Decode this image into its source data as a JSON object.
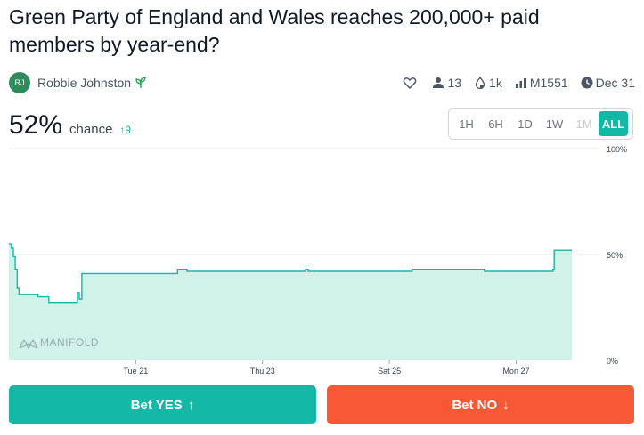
{
  "market": {
    "title": "Green Party of England and Wales reaches 200,000+ paid members by year-end?"
  },
  "author": {
    "initials": "RJ",
    "name": "Robbie Johnston",
    "avatar_color": "#2f8a5c",
    "badge_icon": "sprout-icon"
  },
  "stats": {
    "traders": "13",
    "liquidity": "1k",
    "volume": "Ṁ1551",
    "close_date": "Dec 31"
  },
  "probability": {
    "value": "52%",
    "label": "chance",
    "change": "9"
  },
  "time_ranges": [
    {
      "label": "1H",
      "state": "normal"
    },
    {
      "label": "6H",
      "state": "normal"
    },
    {
      "label": "1D",
      "state": "normal"
    },
    {
      "label": "1W",
      "state": "normal"
    },
    {
      "label": "1M",
      "state": "disabled"
    },
    {
      "label": "ALL",
      "state": "active"
    }
  ],
  "colors": {
    "accent": "#11b8a5",
    "yes": "#14b8a6",
    "no": "#f75836",
    "chart_line": "#14b8a6",
    "chart_fill": "#d1f2e8"
  },
  "chart_data": {
    "type": "area",
    "watermark": "MANIFOLD",
    "y_tick_labels": [
      "100%",
      "50%",
      "0%"
    ],
    "x_tick_labels": [
      "Tue 21",
      "Thu 23",
      "Sat 25",
      "Mon 27"
    ],
    "ylim": [
      0,
      100
    ],
    "xlim": [
      19.0,
      28.3
    ],
    "x_tick_values": [
      21,
      23,
      25,
      27
    ],
    "y_tick_values": [
      100,
      50,
      0
    ],
    "grid": true,
    "series": [
      {
        "points": [
          [
            19.0,
            55
          ],
          [
            19.04,
            55
          ],
          [
            19.04,
            53
          ],
          [
            19.07,
            53
          ],
          [
            19.07,
            49
          ],
          [
            19.1,
            49
          ],
          [
            19.1,
            43
          ],
          [
            19.13,
            43
          ],
          [
            19.13,
            34
          ],
          [
            19.16,
            34
          ],
          [
            19.16,
            31
          ],
          [
            19.46,
            31
          ],
          [
            19.46,
            30
          ],
          [
            19.63,
            30
          ],
          [
            19.63,
            27
          ],
          [
            20.08,
            27
          ],
          [
            20.08,
            32
          ],
          [
            20.11,
            32
          ],
          [
            20.11,
            29
          ],
          [
            20.15,
            29
          ],
          [
            20.15,
            41
          ],
          [
            21.66,
            41
          ],
          [
            21.66,
            43
          ],
          [
            21.81,
            43
          ],
          [
            21.81,
            42
          ],
          [
            23.68,
            42
          ],
          [
            23.68,
            43
          ],
          [
            23.72,
            43
          ],
          [
            23.72,
            42
          ],
          [
            25.36,
            42
          ],
          [
            25.36,
            43
          ],
          [
            26.5,
            43
          ],
          [
            26.5,
            42
          ],
          [
            27.58,
            42
          ],
          [
            27.58,
            43
          ],
          [
            27.6,
            43
          ],
          [
            27.6,
            52
          ],
          [
            27.88,
            52
          ]
        ]
      }
    ]
  },
  "buttons": {
    "yes_label": "Bet YES",
    "no_label": "Bet NO",
    "yes_arrow": "↑",
    "no_arrow": "↓"
  }
}
